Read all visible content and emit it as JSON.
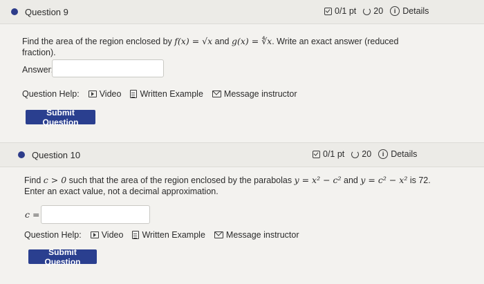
{
  "q9": {
    "title": "Question 9",
    "score": "0/1 pt",
    "attempts": "20",
    "details": "Details",
    "prompt_line1_a": "Find the area of the region enclosed by ",
    "f_expr": "f(x) = √x",
    "and": " and ",
    "g_expr": "g(x) = ∜x",
    "prompt_line1_b": ". Write an exact answer (reduced",
    "prompt_line2": "fraction).",
    "answer_label": "Answer:",
    "answer_value": "",
    "help_label": "Question Help:",
    "video": "Video",
    "written_example": "Written Example",
    "message_instructor": "Message instructor",
    "submit": "Submit Question"
  },
  "q10": {
    "title": "Question 10",
    "score": "0/1 pt",
    "attempts": "20",
    "details": "Details",
    "prompt_a": "Find ",
    "c_cond": "c > 0",
    "prompt_b": " such that the area of the region enclosed by the parabolas ",
    "parab1": "y = x² − c²",
    "and": " and ",
    "parab2": "y = c² − x²",
    "prompt_c": " is 72.",
    "prompt_line2": "Enter an exact value, not a decimal approximation.",
    "c_label": "c =",
    "c_value": "",
    "help_label": "Question Help:",
    "video": "Video",
    "written_example": "Written Example",
    "message_instructor": "Message instructor",
    "submit": "Submit Question"
  },
  "colors": {
    "accent": "#2a3f8f",
    "dot": "#2d3c8a",
    "header_bg": "#ecebe7",
    "page_bg": "#f3f2ef"
  },
  "icons": [
    "checkbox-icon",
    "retry-icon",
    "info-icon",
    "video-icon",
    "document-icon",
    "mail-icon"
  ]
}
